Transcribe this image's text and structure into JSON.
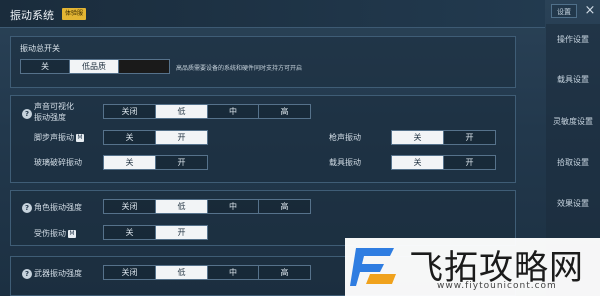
{
  "header": {
    "title": "振动系统",
    "badge": "体验服",
    "back": "设置",
    "close": "×"
  },
  "nav": [
    "操作设置",
    "载具设置",
    "灵敏度设置",
    "拾取设置",
    "效果设置"
  ],
  "master": {
    "title": "振动总开关",
    "options": [
      "关",
      "低品质",
      ""
    ],
    "active": 1,
    "hint": "高品质需要设备的系统和硬件同时支持方可开启"
  },
  "sound": {
    "title_line1": "声音可视化",
    "title_line2": "振动强度",
    "help": "?",
    "options": [
      "关闭",
      "低",
      "中",
      "高"
    ],
    "active": 1,
    "footstep": {
      "label": "脚步声振动",
      "options": [
        "关",
        "开"
      ],
      "active": 1
    },
    "gunshot": {
      "label": "枪声振动",
      "options": [
        "关",
        "开"
      ],
      "active": 0
    },
    "glass": {
      "label": "玻璃破碎振动",
      "options": [
        "关",
        "开"
      ],
      "active": 0
    },
    "vehicle": {
      "label": "载具振动",
      "options": [
        "关",
        "开"
      ],
      "active": 0
    }
  },
  "character": {
    "title": "角色振动强度",
    "help": "?",
    "options": [
      "关闭",
      "低",
      "中",
      "高"
    ],
    "active": 1,
    "hurt": {
      "label": "受伤振动",
      "options": [
        "关",
        "开"
      ],
      "active": 1
    }
  },
  "weapon": {
    "title": "武器振动强度",
    "help": "?",
    "options": [
      "关闭",
      "低",
      "中",
      "高"
    ],
    "active": 1
  },
  "vip_mark": "M",
  "watermark": {
    "text": "飞拓攻略网",
    "url": "www.fiytounicont.com"
  }
}
